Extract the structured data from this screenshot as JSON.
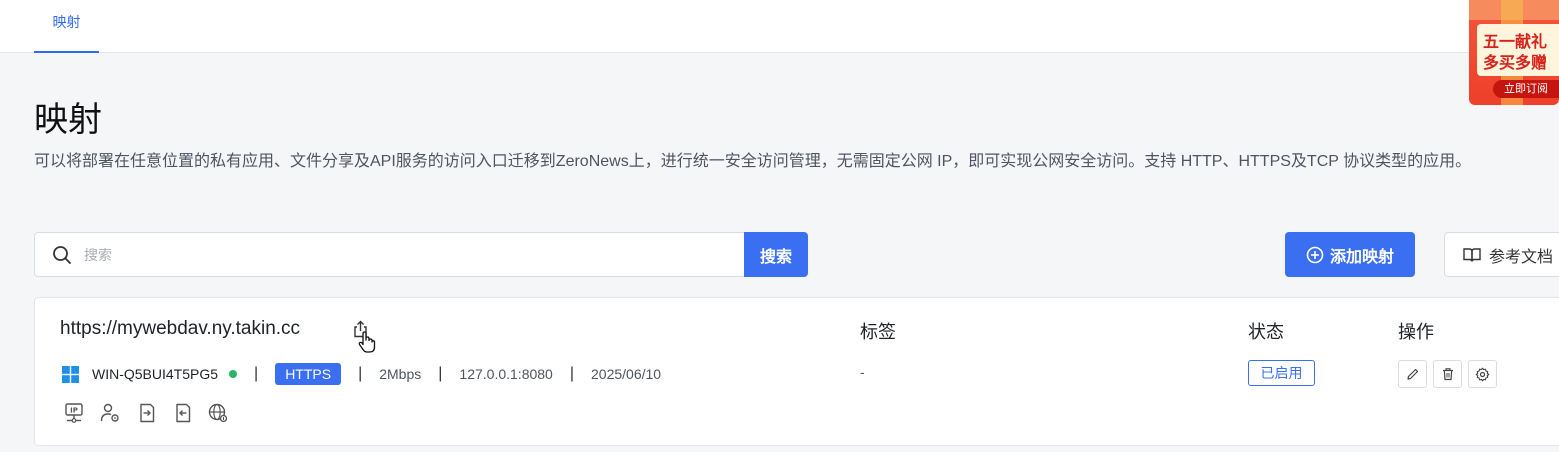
{
  "tabs": [
    {
      "label": "映射",
      "active": true
    }
  ],
  "header": {
    "title": "映射",
    "description": "可以将部署在任意位置的私有应用、文件分享及API服务的访问入口迁移到ZeroNews上，进行统一安全访问管理，无需固定公网 IP，即可实现公网安全访问。支持 HTTP、HTTPS及TCP 协议类型的应用。"
  },
  "search": {
    "placeholder": "搜索",
    "value": "",
    "button_label": "搜索"
  },
  "actions": {
    "add_label": "添加映射",
    "docs_label": "参考文档"
  },
  "columns": {
    "tags": "标签",
    "status": "状态",
    "ops": "操作"
  },
  "mappings": [
    {
      "url": "https://mywebdav.ny.takin.cc",
      "agent": "WIN-Q5BUI4T5PG5",
      "agent_online": true,
      "protocol": "HTTPS",
      "bandwidth": "2Mbps",
      "target": "127.0.0.1:8080",
      "date": "2025/06/10",
      "tags": "-",
      "status": "已启用"
    }
  ],
  "promo": {
    "line1": "五一献礼",
    "line2": "多买多赠",
    "button": "立即订阅"
  },
  "colors": {
    "accent": "#3b6ff1",
    "online": "#28b463",
    "promo": "#ee3f2a"
  },
  "icons": [
    "search-icon",
    "plus-circle-icon",
    "book-icon",
    "share-icon",
    "pointer-hand-icon",
    "windows-icon",
    "edit-icon",
    "trash-icon",
    "gear-icon",
    "ip-icon",
    "user-gear-icon",
    "login-icon",
    "logout-icon",
    "globe-icon"
  ]
}
